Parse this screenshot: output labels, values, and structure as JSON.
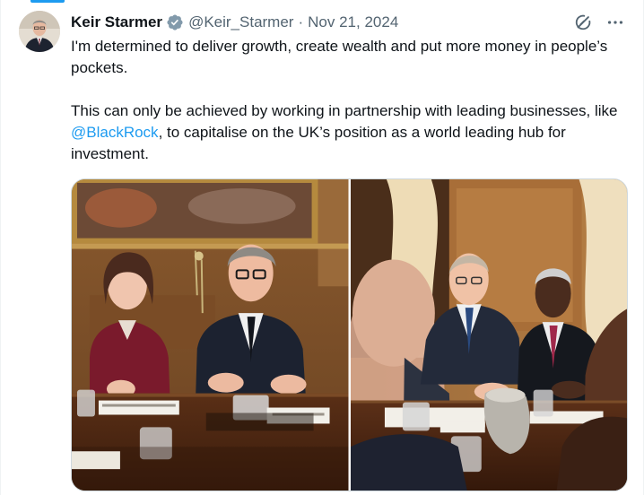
{
  "post": {
    "author_name": "Keir Starmer",
    "handle": "@Keir_Starmer",
    "separator": "·",
    "date": "Nov 21, 2024",
    "paragraph1": "I'm determined to deliver growth, create wealth and put more money in people’s pockets.",
    "paragraph2_before": "This can only be achieved by working in partnership with leading businesses, like ",
    "mention": "@BlackRock",
    "paragraph2_after": ", to capitalise on the UK’s position as a world leading hub for investment."
  },
  "icons": {
    "verified": "verified-badge-icon",
    "grok": "grok-icon",
    "more": "more-options-icon"
  },
  "colors": {
    "accent": "#1d9bf0",
    "text": "#0f1419",
    "muted": "#536471"
  }
}
